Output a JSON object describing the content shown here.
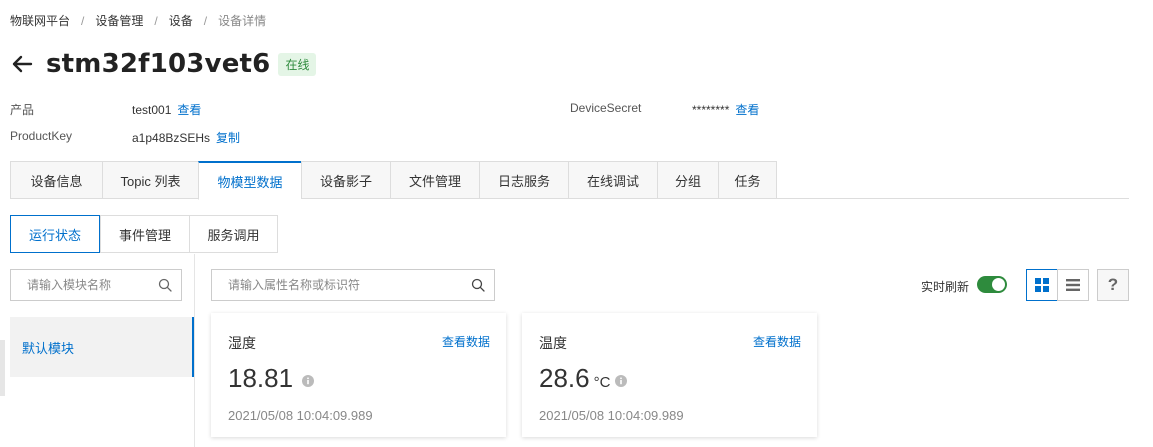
{
  "breadcrumb": [
    "物联网平台",
    "设备管理",
    "设备",
    "设备详情"
  ],
  "breadcrumb_separator": "/",
  "header": {
    "title": "stm32f103vet6",
    "status": "在线",
    "status_color": "#2e8b3d"
  },
  "meta": {
    "product_label": "产品",
    "product_value": "test001",
    "product_link": "查看",
    "productkey_label": "ProductKey",
    "productkey_value": "a1p48BzSEHs",
    "productkey_link": "复制",
    "secret_label": "DeviceSecret",
    "secret_value": "********",
    "secret_link": "查看"
  },
  "tabs": [
    {
      "label": "设备信息"
    },
    {
      "label": "Topic 列表"
    },
    {
      "label": "物模型数据",
      "active": true
    },
    {
      "label": "设备影子"
    },
    {
      "label": "文件管理"
    },
    {
      "label": "日志服务"
    },
    {
      "label": "在线调试"
    },
    {
      "label": "分组"
    },
    {
      "label": "任务"
    }
  ],
  "subtabs": [
    {
      "label": "运行状态",
      "active": true
    },
    {
      "label": "事件管理"
    },
    {
      "label": "服务调用"
    }
  ],
  "module_search": {
    "placeholder": "请输入模块名称"
  },
  "property_search": {
    "placeholder": "请输入属性名称或标识符"
  },
  "modules": [
    {
      "label": "默认模块",
      "active": true
    }
  ],
  "toolbar": {
    "realtime_label": "实时刷新",
    "realtime_on": true,
    "help_label": "?"
  },
  "cards": [
    {
      "title": "湿度",
      "link": "查看数据",
      "value": "18.81",
      "unit": "",
      "time": "2021/05/08 10:04:09.989"
    },
    {
      "title": "温度",
      "link": "查看数据",
      "value": "28.6",
      "unit": "°C",
      "time": "2021/05/08 10:04:09.989"
    }
  ],
  "colors": {
    "accent": "#0070cc",
    "online_bg": "#e4f5e6",
    "toggle_on": "#2e8b3d"
  },
  "icons": [
    "back-arrow-icon",
    "search-icon",
    "grid-view-icon",
    "list-view-icon",
    "help-icon",
    "info-icon"
  ]
}
